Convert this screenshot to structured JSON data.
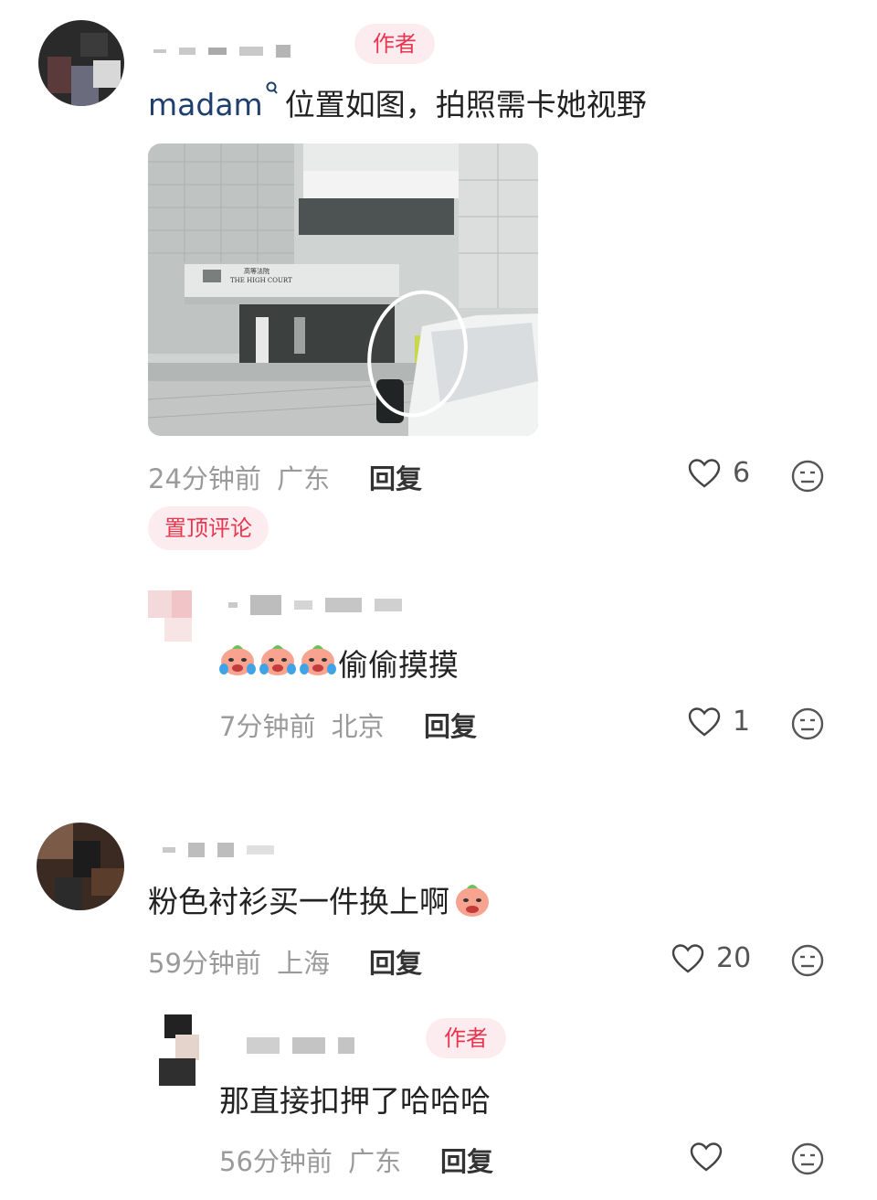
{
  "comments": [
    {
      "author_badge": "作者",
      "mention": "madam",
      "text": "位置如图，拍照需卡她视野",
      "photo": {
        "sign_cn": "高等法院",
        "sign_en": "THE HIGH COURT"
      },
      "time": "24分钟前",
      "location": "广东",
      "reply_label": "回复",
      "likes": "6",
      "pinned_label": "置顶评论",
      "replies": [
        {
          "text": "偷偷摸摸",
          "time": "7分钟前",
          "location": "北京",
          "reply_label": "回复",
          "likes": "1"
        }
      ]
    },
    {
      "text": "粉色衬衫买一件换上啊",
      "time": "59分钟前",
      "location": "上海",
      "reply_label": "回复",
      "likes": "20",
      "replies": [
        {
          "author_badge": "作者",
          "text": "那直接扣押了哈哈哈",
          "time": "56分钟前",
          "location": "广东",
          "reply_label": "回复",
          "likes": ""
        }
      ]
    }
  ],
  "icons": {
    "like": "heart-outline-icon",
    "emoji": "smiley-face-icon",
    "sticker": "crying-peach-emoji"
  },
  "colors": {
    "accent": "#e8364f",
    "badge_bg": "#fdecef",
    "mention": "#1f3f6e",
    "meta": "#9a9a9a"
  }
}
